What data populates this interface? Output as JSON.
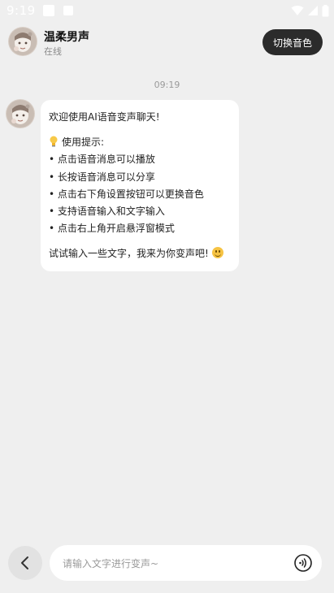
{
  "status_bar": {
    "time": "9:19"
  },
  "header": {
    "name": "温柔男声",
    "status": "在线",
    "switch_voice_label": "切换音色"
  },
  "chat": {
    "timestamp": "09:19",
    "message": {
      "lines": [
        "欢迎使用AI语音变声聊天!",
        "",
        "使用提示:",
        "• 点击语音消息可以播放",
        "• 长按语音消息可以分享",
        "• 点击右下角设置按钮可以更换音色",
        "• 支持语音输入和文字输入",
        "• 点击右上角开启悬浮窗模式",
        "",
        "试试输入一些文字，我来为你变声吧!"
      ]
    }
  },
  "input": {
    "placeholder": "请输入文字进行变声~",
    "value": ""
  }
}
